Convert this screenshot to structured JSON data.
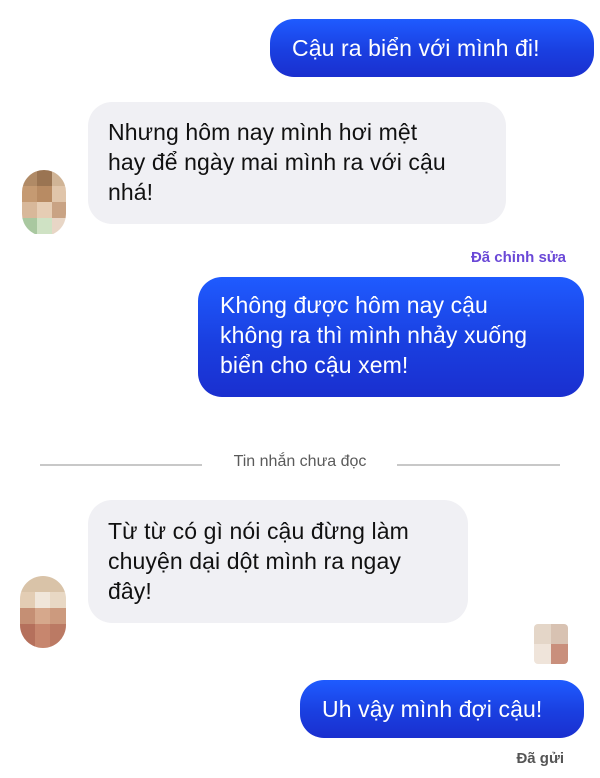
{
  "messages": [
    {
      "id": "m1",
      "side": "sent",
      "text": "Cậu ra biển với mình đi!"
    },
    {
      "id": "m2",
      "side": "received",
      "lines": [
        "Nhưng hôm nay mình hơi mệt",
        "hay để ngày mai mình ra với cậu",
        "nhá!"
      ]
    },
    {
      "id": "m3",
      "side": "sent",
      "status": "Đã chỉnh sửa",
      "lines": [
        "Không được hôm nay cậu",
        "không ra thì mình nhảy xuống",
        "biển cho cậu xem!"
      ]
    },
    {
      "id": "m4",
      "side": "received",
      "lines": [
        "Từ từ có gì nói cậu đừng làm",
        "chuyện dại dột mình ra ngay",
        "đây!"
      ]
    },
    {
      "id": "m5",
      "side": "sent",
      "text": "Uh vậy mình đợi cậu!",
      "status": "Đã gửi"
    }
  ],
  "unread_divider": "Tin nhắn chưa đọc",
  "colors": {
    "sent_bubble": "#1f4ff0",
    "received_bubble": "#f0f0f4",
    "edited_label": "#6a48d7",
    "divider": "#c8c8c8"
  }
}
